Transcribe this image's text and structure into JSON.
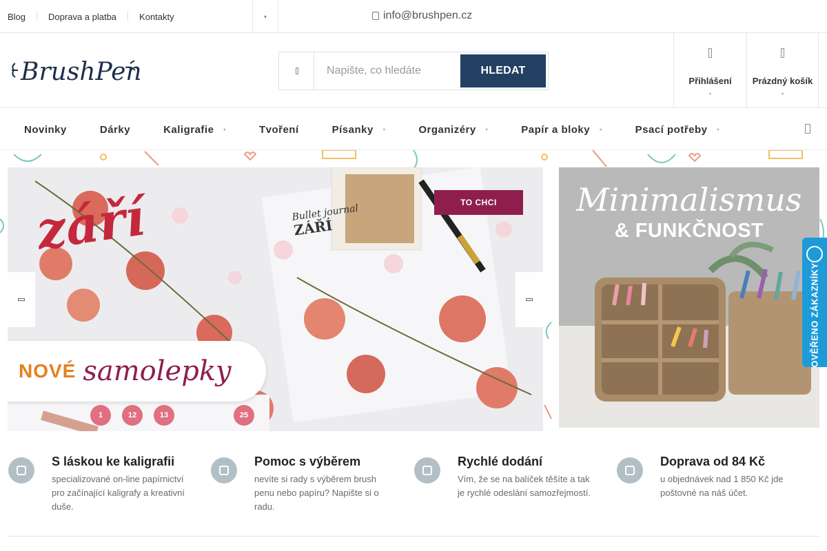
{
  "topbar": {
    "links": [
      "Blog",
      "Doprava a platba",
      "Kontakty"
    ],
    "email": "info@brushpen.cz"
  },
  "header": {
    "logo_text": "BrushPen",
    "search": {
      "placeholder": "Napište, co hledáte",
      "button": "HLEDAT"
    },
    "login_label": "Přihlášení",
    "cart_label": "Prázdný košík"
  },
  "nav": {
    "items": [
      {
        "label": "Novinky",
        "dropdown": false
      },
      {
        "label": "Dárky",
        "dropdown": false
      },
      {
        "label": "Kaligrafie",
        "dropdown": true
      },
      {
        "label": "Tvoření",
        "dropdown": false
      },
      {
        "label": "Písanky",
        "dropdown": true
      },
      {
        "label": "Organizéry",
        "dropdown": true
      },
      {
        "label": "Papír a bloky",
        "dropdown": true
      },
      {
        "label": "Psací potřeby",
        "dropdown": true
      }
    ]
  },
  "banner_left": {
    "headline": "září",
    "notebook_text": "Bullet journal",
    "notebook_month": "ZÁŘÍ",
    "cta": "TO CHCI",
    "label_1": "NOVÉ",
    "label_2": "samolepky",
    "sticker_numbers": [
      "1",
      "12",
      "13",
      "25"
    ]
  },
  "banner_right": {
    "title": "Minimalismus",
    "subtitle": "& FUNKČNOST"
  },
  "verified_badge": "OVĚŘENO ZÁKAZNÍKY",
  "features": [
    {
      "title": "S láskou ke kaligrafii",
      "text": "specializované on-line papírnictví pro začínající kaligrafy a kreativní duše.",
      "icon": "pen-nib-icon"
    },
    {
      "title": "Pomoc s výběrem",
      "text": "nevíte si rady s výběrem brush penu nebo papíru? Napište si o radu.",
      "icon": "help-hand-icon"
    },
    {
      "title": "Rychlé dodání",
      "text": "Vím, že se na balíček těšíte a tak je rychlé odeslání samozřejmostí.",
      "icon": "delivery-truck-icon"
    },
    {
      "title": "Doprava od 84 Kč",
      "text": "u objednávek nad 1 850 Kč jde poštovné na náš účet.",
      "icon": "money-hand-icon"
    }
  ],
  "colors": {
    "primary": "#234062",
    "accent": "#8e1f4d",
    "badge": "#1c9bd8",
    "feature_icon": "#b2bfc6"
  }
}
